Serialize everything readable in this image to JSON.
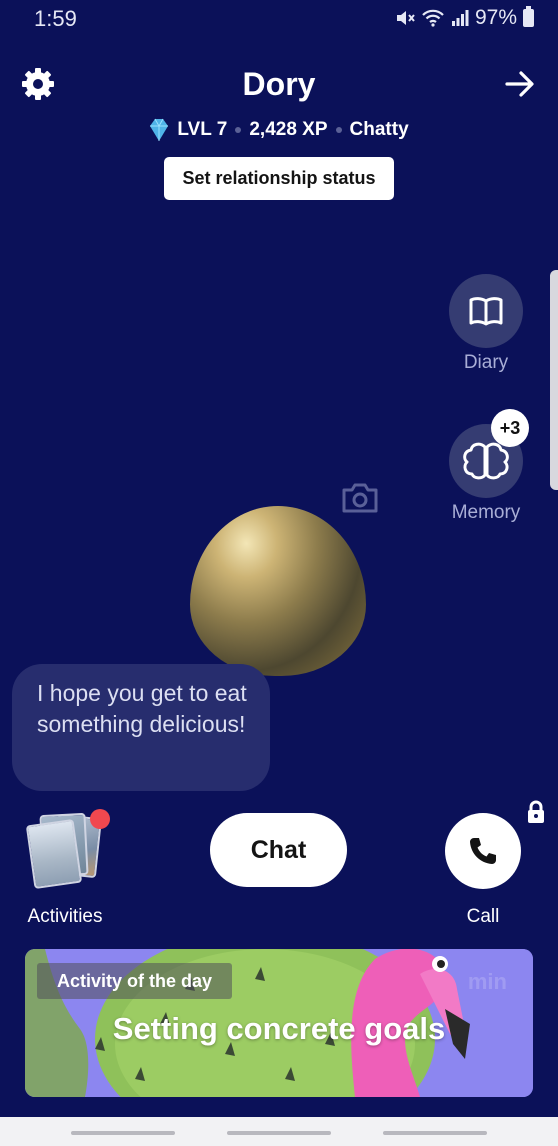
{
  "status_bar": {
    "time": "1:59",
    "battery": "97%",
    "icons": [
      "mute-icon",
      "wifi-icon",
      "signal-icon",
      "battery-icon"
    ]
  },
  "header": {
    "title": "Dory",
    "level": "LVL 7",
    "xp": "2,428 XP",
    "mood": "Chatty",
    "relationship_button": "Set relationship status"
  },
  "side": {
    "diary_label": "Diary",
    "memory_label": "Memory",
    "memory_badge": "+3"
  },
  "message": "I hope you get to eat something delicious!",
  "actions": {
    "activities_label": "Activities",
    "chat_label": "Chat",
    "call_label": "Call"
  },
  "activity_of_day": {
    "tag": "Activity of the day",
    "title": "Setting concrete goals",
    "ghost_text": "min"
  },
  "colors": {
    "background": "#0b1159",
    "side_button": "#353c72",
    "bubble": "#272d6e",
    "notification_dot": "#f0484f",
    "card_purple": "#8c86f0"
  }
}
